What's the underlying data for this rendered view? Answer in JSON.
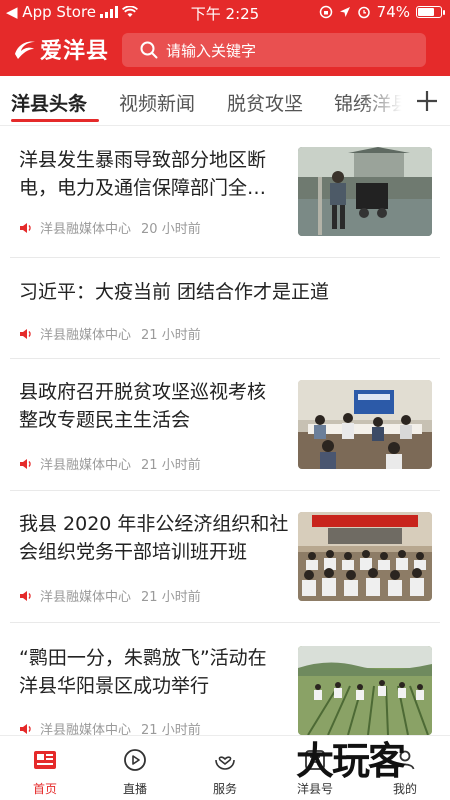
{
  "status_bar": {
    "carrier": "◀ App Store",
    "time": "下午 2:25",
    "battery": "74%",
    "battery_level": 0.74
  },
  "header": {
    "logo_text": "爱洋县",
    "search_placeholder": "请输入关键字"
  },
  "tabs": [
    {
      "label": "洋县头条",
      "active": true
    },
    {
      "label": "视频新闻",
      "active": false
    },
    {
      "label": "脱贫攻坚",
      "active": false
    },
    {
      "label": "锦绣洋县",
      "active": false
    }
  ],
  "news": [
    {
      "title_line1": "洋县发生暴雨导致部分地区断",
      "title_line2": "电，电力及通信保障部门全…",
      "source": "洋县融媒体中心",
      "time": "20 小时前",
      "thumbnail": "flood-repair-photo"
    },
    {
      "title_line1": "习近平：大疫当前 团结合作才是正道",
      "title_line2": "",
      "source": "洋县融媒体中心",
      "time": "21 小时前",
      "thumbnail": ""
    },
    {
      "title_line1": "县政府召开脱贫攻坚巡视考核",
      "title_line2": "整改专题民主生活会",
      "source": "洋县融媒体中心",
      "time": "21 小时前",
      "thumbnail": "meeting-room-photo"
    },
    {
      "title_line1": "我县 2020 年非公经济组织和社",
      "title_line2": "会组织党务干部培训班开班",
      "source": "洋县融媒体中心",
      "time": "21 小时前",
      "thumbnail": "training-hall-photo"
    },
    {
      "title_line1": "“鹮田一分，朱鹮放飞”活动在",
      "title_line2": "洋县华阳景区成功举行",
      "source": "洋县融媒体中心",
      "time": "21 小时前",
      "thumbnail": "rice-field-photo"
    }
  ],
  "bottom_nav": [
    {
      "label": "首页",
      "icon": "home-news-icon",
      "active": true
    },
    {
      "label": "直播",
      "icon": "play-icon",
      "active": false
    },
    {
      "label": "服务",
      "icon": "heart-hands-icon",
      "active": false
    },
    {
      "label": "洋县号",
      "icon": "account-icon",
      "active": false
    },
    {
      "label": "我的",
      "icon": "user-icon",
      "active": false
    }
  ],
  "watermark": "大玩客",
  "colors": {
    "brand_red": "#e52a2a",
    "meta_gray": "#9a9a9a"
  }
}
